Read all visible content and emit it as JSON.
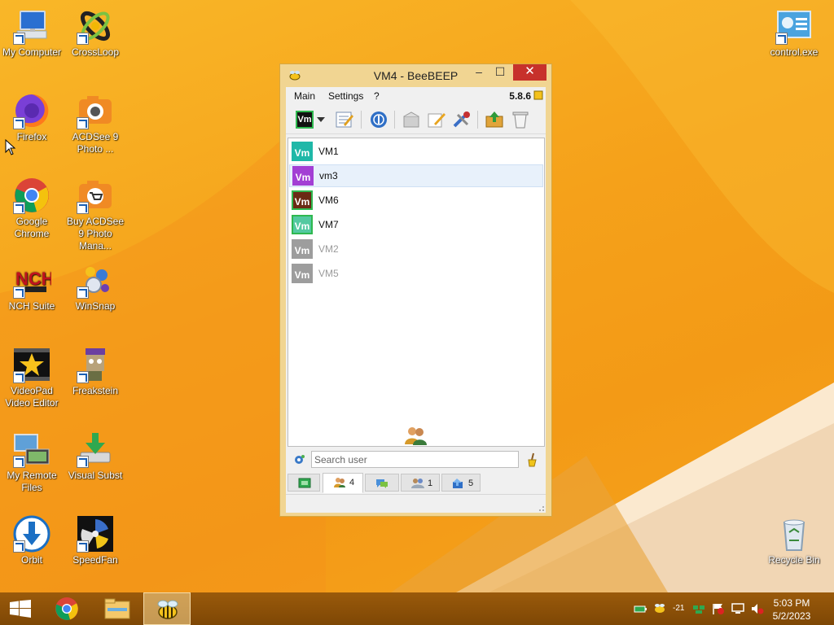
{
  "desktop": {
    "icons": [
      {
        "label": "My Computer",
        "icon": "computer-icon"
      },
      {
        "label": "CrossLoop",
        "icon": "crossloop-icon"
      },
      {
        "label": "Firefox",
        "icon": "firefox-icon"
      },
      {
        "label": "ACDSee 9 Photo ...",
        "icon": "acdsee-icon"
      },
      {
        "label": "Google Chrome",
        "icon": "chrome-icon"
      },
      {
        "label": "Buy ACDSee 9 Photo Mana...",
        "icon": "acdsee-buy-icon"
      },
      {
        "label": "NCH Suite",
        "icon": "nch-icon"
      },
      {
        "label": "WinSnap",
        "icon": "winsnap-icon"
      },
      {
        "label": "VideoPad Video Editor",
        "icon": "videopad-icon"
      },
      {
        "label": "Freakstein",
        "icon": "freakstein-icon"
      },
      {
        "label": "My Remote Files",
        "icon": "remote-files-icon"
      },
      {
        "label": "Visual Subst",
        "icon": "visual-subst-icon"
      },
      {
        "label": "Orbit",
        "icon": "orbit-icon"
      },
      {
        "label": "SpeedFan",
        "icon": "speedfan-icon"
      },
      {
        "label": "control.exe",
        "icon": "control-panel-icon"
      },
      {
        "label": "Recycle Bin",
        "icon": "recycle-bin-icon"
      }
    ]
  },
  "window": {
    "title": "VM4 - BeeBEEP",
    "controls": {
      "minimize": "–",
      "maximize": "☐",
      "close": "✕"
    },
    "menu": {
      "main": "Main",
      "settings": "Settings",
      "help": "?",
      "version": "5.8.6"
    },
    "toolbar": {
      "status_avatar": "Vm",
      "buttons": [
        "edit-profile-icon",
        "network-icon",
        "send-file-icon",
        "write-message-icon",
        "tools-icon",
        "share-folder-icon",
        "clear-icon"
      ]
    },
    "users": [
      {
        "avatar": "Vm",
        "name": "VM1",
        "color": "#1fb8a8",
        "online": true
      },
      {
        "avatar": "Vm",
        "name": "vm3",
        "color": "#a33fd4",
        "online": true
      },
      {
        "avatar": "Vm",
        "name": "VM6",
        "color": "#6b2a14",
        "online": true
      },
      {
        "avatar": "Vm",
        "name": "VM7",
        "color": "#53c9a0",
        "online": true
      },
      {
        "avatar": "Vm",
        "name": "VM2",
        "color": "#9d9d9d",
        "online": false
      },
      {
        "avatar": "Vm",
        "name": "VM5",
        "color": "#9d9d9d",
        "online": false
      }
    ],
    "search": {
      "placeholder": "Search user",
      "value": ""
    },
    "tabs": [
      {
        "name": "home",
        "count": ""
      },
      {
        "name": "users",
        "count": "4"
      },
      {
        "name": "chats",
        "count": ""
      },
      {
        "name": "groups",
        "count": "1"
      },
      {
        "name": "shares",
        "count": "5"
      }
    ]
  },
  "taskbar": {
    "tray_number": "-21",
    "time": "5:03 PM",
    "date": "5/2/2023"
  }
}
